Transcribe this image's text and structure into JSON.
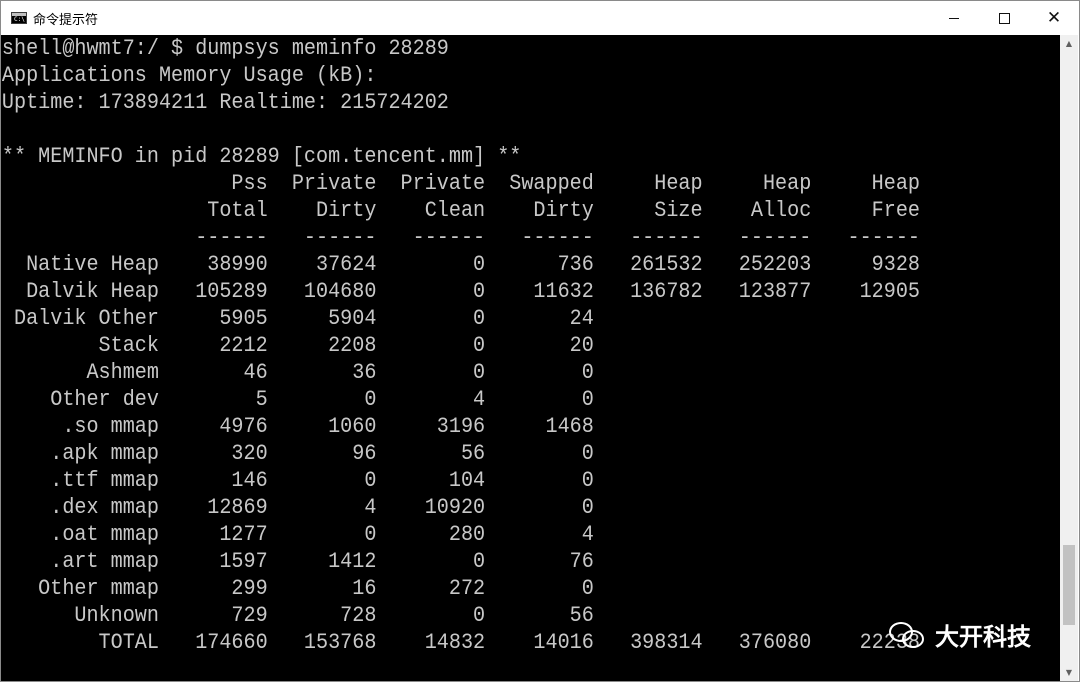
{
  "window": {
    "title": "命令提示符",
    "icon_label": "C:\\",
    "minimize_icon": "minimize-icon",
    "maximize_icon": "maximize-icon",
    "close_icon": "close-icon"
  },
  "terminal": {
    "lines": [
      "shell@hwmt7:/ $ dumpsys meminfo 28289",
      "Applications Memory Usage (kB):",
      "Uptime: 173894211 Realtime: 215724202",
      "",
      "** MEMINFO in pid 28289 [com.tencent.mm] **",
      "                   Pss  Private  Private  Swapped     Heap     Heap     Heap",
      "                 Total    Dirty    Clean    Dirty     Size    Alloc     Free",
      "                ------   ------   ------   ------   ------   ------   ------",
      "  Native Heap    38990    37624        0      736   261532   252203     9328",
      "  Dalvik Heap   105289   104680        0    11632   136782   123877    12905",
      " Dalvik Other     5905     5904        0       24",
      "        Stack     2212     2208        0       20",
      "       Ashmem       46       36        0        0",
      "    Other dev        5        0        4        0",
      "     .so mmap     4976     1060     3196     1468",
      "    .apk mmap      320       96       56        0",
      "    .ttf mmap      146        0      104        0",
      "    .dex mmap    12869        4    10920        0",
      "    .oat mmap     1277        0      280        4",
      "    .art mmap     1597     1412        0       76",
      "   Other mmap      299       16      272        0",
      "      Unknown      729      728        0       56",
      "        TOTAL   174660   153768    14832    14016   398314   376080    22238"
    ]
  },
  "watermark": {
    "text": "大开科技",
    "icon": "wechat-icon"
  }
}
